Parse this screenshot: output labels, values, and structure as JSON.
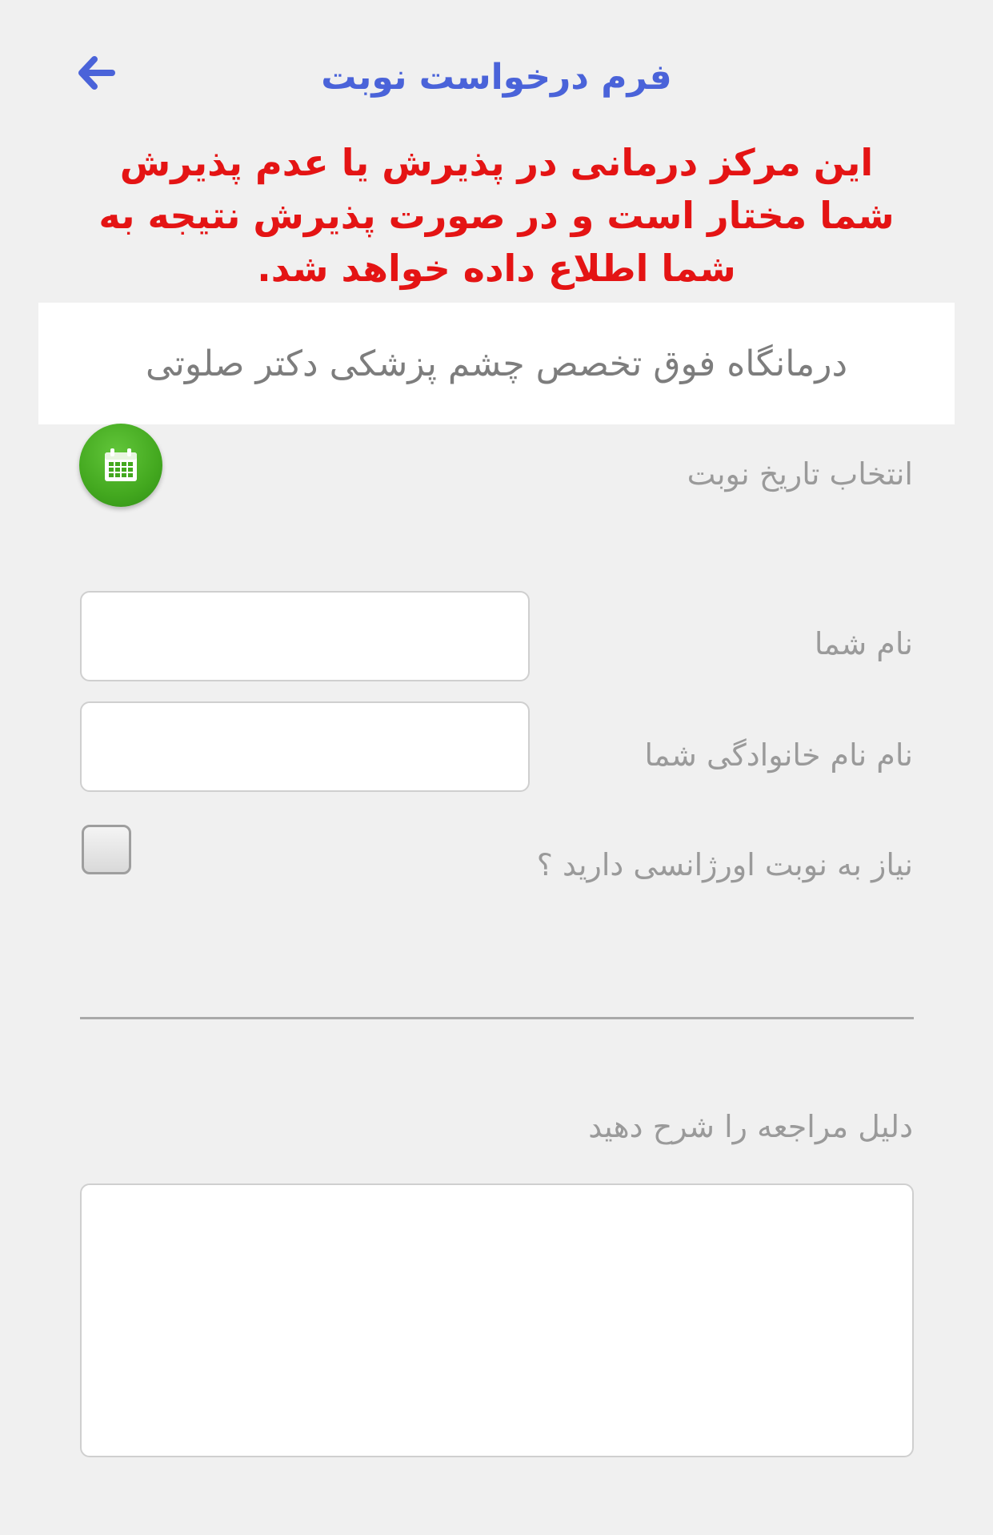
{
  "header": {
    "title": "فرم درخواست نوبت",
    "back_icon": "arrow-left-icon",
    "title_color": "#4a63d9"
  },
  "notice": {
    "text": "این مرکز درمانی در پذیرش یا عدم پذیرش شما مختار است و در صورت پذیرش نتیجه به شما اطلاع داده خواهد شد.",
    "color": "#e41414"
  },
  "clinic": {
    "name": "درمانگاه فوق تخصص چشم پزشکی دکتر صلوتی"
  },
  "form": {
    "date_label": "انتخاب تاریخ نوبت",
    "calendar_icon": "calendar-icon",
    "first_name_label": "نام شما",
    "first_name_value": "",
    "last_name_label": "نام نام خانوادگی شما",
    "last_name_value": "",
    "urgent_label": "نیاز به نوبت اورژانسی دارید ؟",
    "urgent_checked": false,
    "reason_label": "دلیل مراجعه را شرح دهید",
    "reason_value": ""
  },
  "colors": {
    "accent_green": "#43a81f",
    "background": "#f0f0f0"
  }
}
